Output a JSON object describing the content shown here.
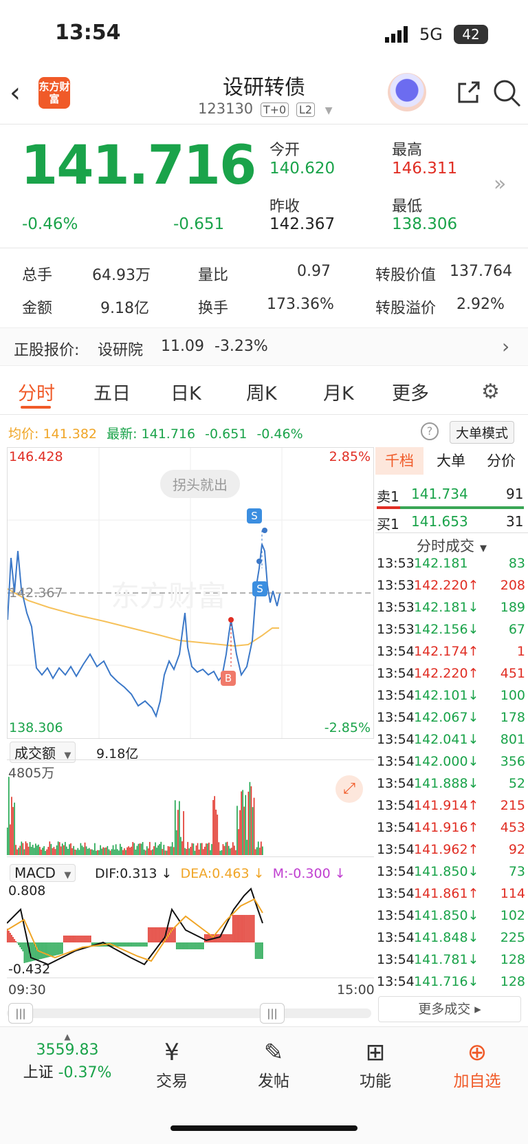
{
  "status": {
    "time": "13:54",
    "network": "5G",
    "battery": "42"
  },
  "header": {
    "title": "设研转债",
    "code": "123130",
    "tag1": "T+0",
    "tag2": "L2",
    "logo": "东方财富"
  },
  "quote": {
    "price": "141.716",
    "pct": "-0.46%",
    "change": "-0.651",
    "open_label": "今开",
    "open": "140.620",
    "high_label": "最高",
    "high": "146.311",
    "prev_label": "昨收",
    "prev": "142.367",
    "low_label": "最低",
    "low": "138.306"
  },
  "stats": {
    "vol_label": "总手",
    "vol": "64.93万",
    "ratio_label": "量比",
    "ratio": "0.97",
    "conv_label": "转股价值",
    "conv": "137.764",
    "amt_label": "金额",
    "amt": "9.18亿",
    "turn_label": "换手",
    "turn": "173.36%",
    "prem_label": "转股溢价",
    "prem": "2.92%"
  },
  "stock": {
    "label": "正股报价:",
    "name": "设研院",
    "price": "11.09",
    "pct": "-3.23%"
  },
  "tabs": [
    "分时",
    "五日",
    "日K",
    "周K",
    "月K",
    "更多"
  ],
  "info": {
    "avg_label": "均价:",
    "avg": "141.382",
    "last_label": "最新:",
    "last": "141.716",
    "chg": "-0.651",
    "pct": "-0.46%",
    "mode": "大单模式"
  },
  "chart": {
    "ymax": "146.428",
    "ymin": "138.306",
    "pmax": "2.85%",
    "pmin": "-2.85%",
    "prev": "142.367",
    "watermark": "东方财富",
    "tip": "拐头就出",
    "s1": "S",
    "s2": "S",
    "b": "B"
  },
  "vol": {
    "label": "成交额",
    "value": "9.18亿",
    "max": "4805万"
  },
  "macd": {
    "label": "MACD",
    "dif": "DIF:0.313 ↓",
    "dea": "DEA:0.463 ↓",
    "m": "M:-0.300 ↓",
    "top": "0.808",
    "bottom": "-0.432",
    "t0": "09:30",
    "t1": "15:00"
  },
  "panel": {
    "tabs": [
      "千档",
      "大单",
      "分价"
    ],
    "sell_label": "卖1",
    "sell_price": "141.734",
    "sell_vol": "91",
    "buy_label": "买1",
    "buy_price": "141.653",
    "buy_vol": "31",
    "ticks_title": "分时成交",
    "more": "更多成交"
  },
  "ticks": [
    {
      "t": "13:53",
      "p": "142.181",
      "d": "",
      "v": "83",
      "c": "g"
    },
    {
      "t": "13:53",
      "p": "142.220",
      "d": "↑",
      "v": "208",
      "c": "r"
    },
    {
      "t": "13:53",
      "p": "142.181",
      "d": "↓",
      "v": "189",
      "c": "g"
    },
    {
      "t": "13:53",
      "p": "142.156",
      "d": "↓",
      "v": "67",
      "c": "g"
    },
    {
      "t": "13:54",
      "p": "142.174",
      "d": "↑",
      "v": "1",
      "c": "r"
    },
    {
      "t": "13:54",
      "p": "142.220",
      "d": "↑",
      "v": "451",
      "c": "r"
    },
    {
      "t": "13:54",
      "p": "142.101",
      "d": "↓",
      "v": "100",
      "c": "g"
    },
    {
      "t": "13:54",
      "p": "142.067",
      "d": "↓",
      "v": "178",
      "c": "g"
    },
    {
      "t": "13:54",
      "p": "142.041",
      "d": "↓",
      "v": "801",
      "c": "g"
    },
    {
      "t": "13:54",
      "p": "142.000",
      "d": "↓",
      "v": "356",
      "c": "g"
    },
    {
      "t": "13:54",
      "p": "141.888",
      "d": "↓",
      "v": "52",
      "c": "g"
    },
    {
      "t": "13:54",
      "p": "141.914",
      "d": "↑",
      "v": "215",
      "c": "r"
    },
    {
      "t": "13:54",
      "p": "141.916",
      "d": "↑",
      "v": "453",
      "c": "r"
    },
    {
      "t": "13:54",
      "p": "141.962",
      "d": "↑",
      "v": "92",
      "c": "r"
    },
    {
      "t": "13:54",
      "p": "141.850",
      "d": "↓",
      "v": "73",
      "c": "g"
    },
    {
      "t": "13:54",
      "p": "141.861",
      "d": "↑",
      "v": "114",
      "c": "r"
    },
    {
      "t": "13:54",
      "p": "141.850",
      "d": "↓",
      "v": "102",
      "c": "g"
    },
    {
      "t": "13:54",
      "p": "141.848",
      "d": "↓",
      "v": "225",
      "c": "g"
    },
    {
      "t": "13:54",
      "p": "141.781",
      "d": "↓",
      "v": "128",
      "c": "g"
    },
    {
      "t": "13:54",
      "p": "141.716",
      "d": "↓",
      "v": "128",
      "c": "g"
    }
  ],
  "nav": {
    "index_value": "3559.83",
    "index_name": "上证",
    "index_pct": "-0.37%",
    "trade": "交易",
    "post": "发帖",
    "func": "功能",
    "add": "加自选"
  }
}
